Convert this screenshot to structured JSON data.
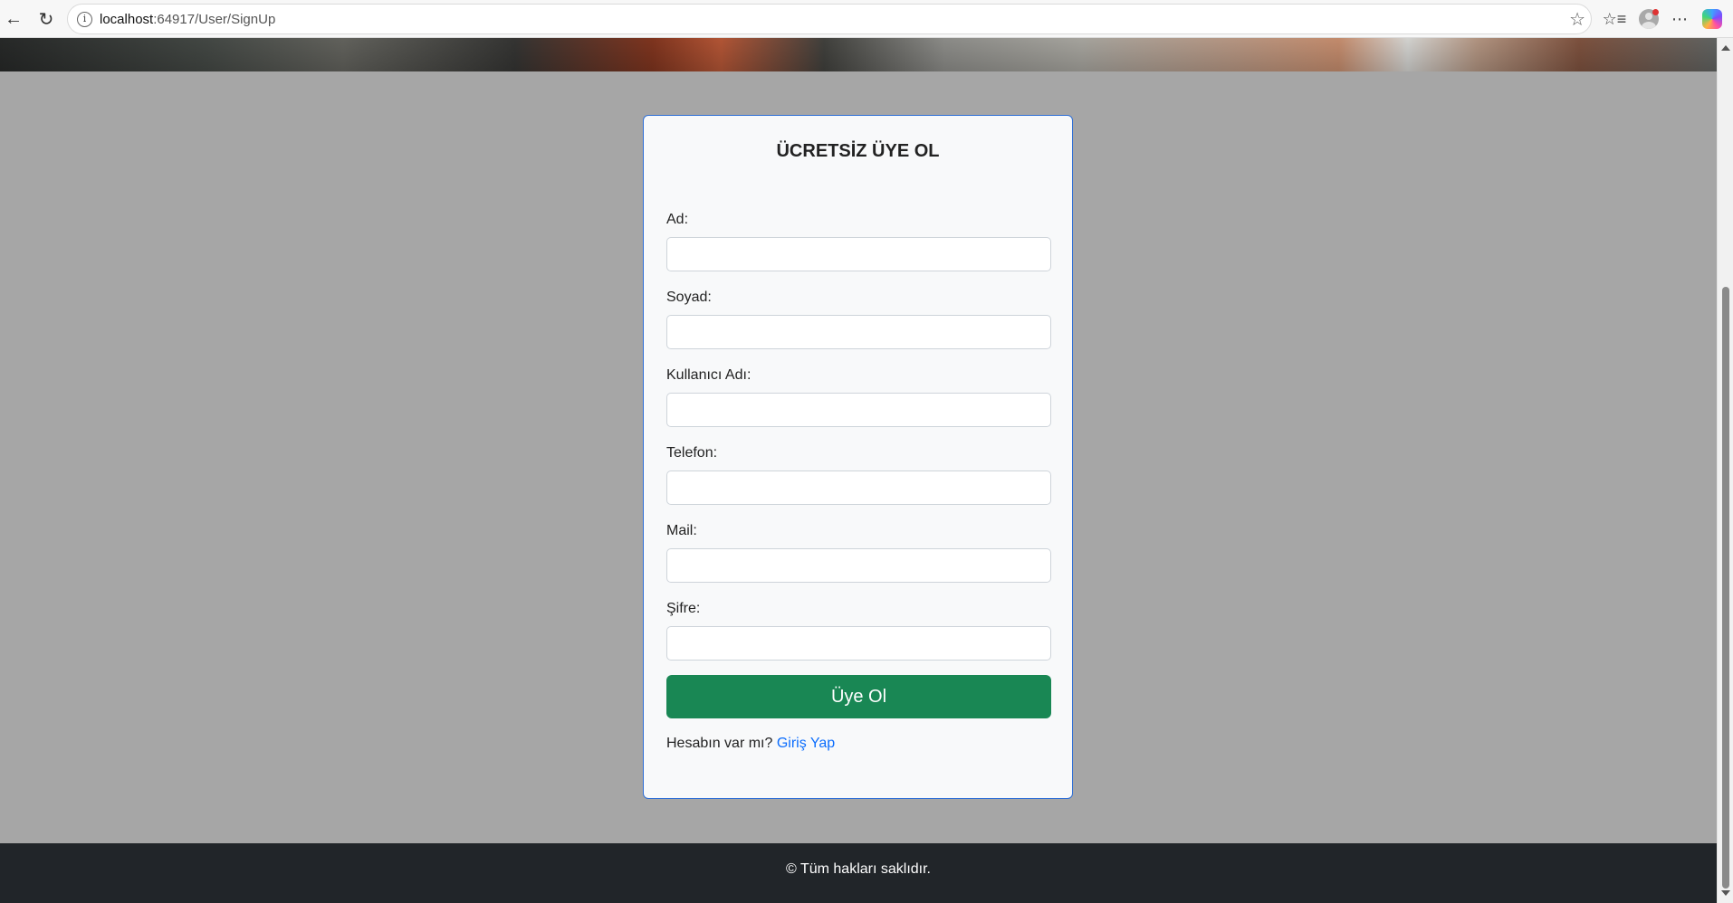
{
  "browser": {
    "back_icon": "back-arrow-icon",
    "reload_icon": "reload-icon",
    "site_info_icon": "info-icon",
    "address_host": "localhost",
    "address_rest": ":64917/User/SignUp",
    "favorite_icon": "star-icon",
    "favorites_icon": "favorites-list-icon",
    "profile_icon": "avatar-icon",
    "more_icon": "ellipsis-icon",
    "copilot_icon": "copilot-icon"
  },
  "form": {
    "title": "ÜCRETSİZ ÜYE OL",
    "fields": [
      {
        "label": "Ad:",
        "value": ""
      },
      {
        "label": "Soyad:",
        "value": ""
      },
      {
        "label": "Kullanıcı Adı:",
        "value": ""
      },
      {
        "label": "Telefon:",
        "value": ""
      },
      {
        "label": "Mail:",
        "value": ""
      },
      {
        "label": "Şifre:",
        "value": ""
      }
    ],
    "submit_label": "Üye Ol",
    "login_prompt": "Hesabın var mı?",
    "login_link": "Giriş Yap"
  },
  "footer": {
    "text": "© Tüm hakları saklıdır."
  },
  "colors": {
    "page_bg": "#a6a6a6",
    "card_border": "#2f6fd6",
    "submit_bg": "#198754",
    "link": "#0d6efd",
    "footer_bg": "#212529"
  }
}
